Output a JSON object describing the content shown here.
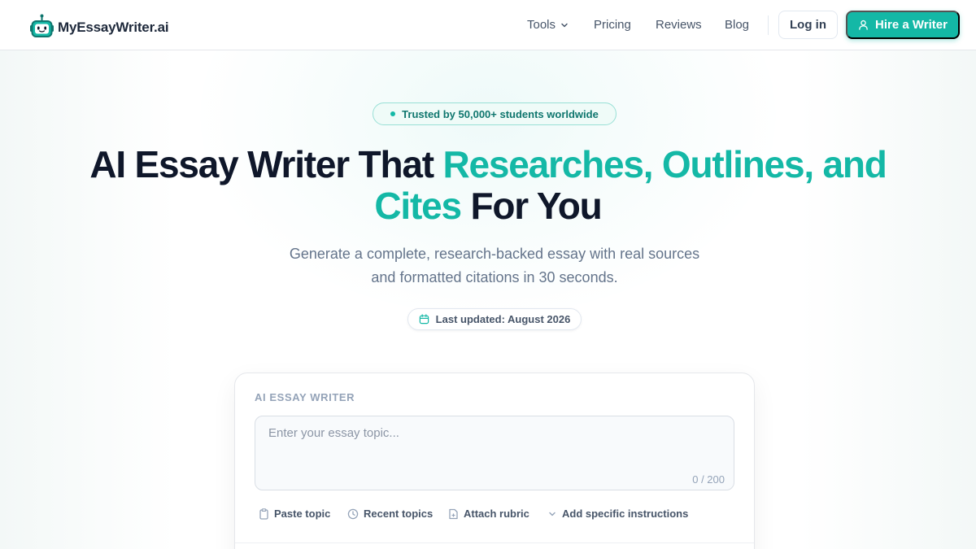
{
  "brand": {
    "name": "MyEssayWriter.ai",
    "accent_color": "#14b8a6",
    "logo_icon": "robot-icon"
  },
  "nav": {
    "tools_label": "Tools",
    "pricing_label": "Pricing",
    "reviews_label": "Reviews",
    "blog_label": "Blog",
    "login_label": "Log in",
    "hire_label": "Hire a Writer"
  },
  "hero": {
    "trust_badge": "Trusted by 50,000+ students worldwide",
    "headline_part1": "AI Essay Writer That ",
    "headline_accent": "Researches, Outlines, and Cites",
    "headline_part2": " For You",
    "subtext": "Generate a complete, research-backed essay with real sources and formatted citations in 30 seconds.",
    "updated_badge": "Last updated: August 2026"
  },
  "writer_card": {
    "label": "AI ESSAY WRITER",
    "topic_placeholder": "Enter your essay topic...",
    "topic_value": "",
    "char_count": "0 / 200",
    "actions": [
      {
        "label": "Paste topic",
        "icon": "clipboard-icon"
      },
      {
        "label": "Recent topics",
        "icon": "clock-icon"
      },
      {
        "label": "Attach rubric",
        "icon": "file-plus-icon"
      },
      {
        "label": "Add specific instructions",
        "icon": "chevron-down-icon"
      }
    ]
  }
}
